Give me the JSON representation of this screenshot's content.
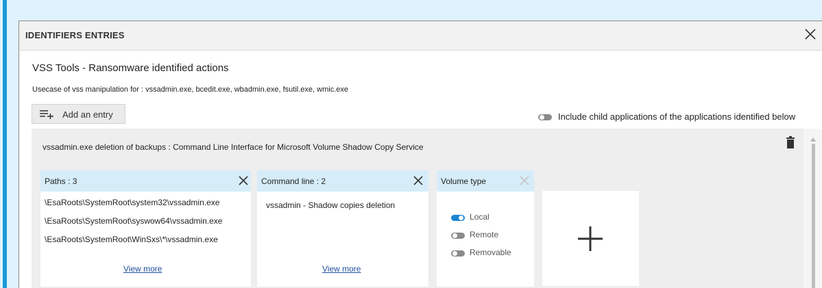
{
  "dialog": {
    "title": "IDENTIFIERS ENTRIES",
    "close_icon": "close-icon"
  },
  "identifier": {
    "name": "VSS Tools - Ransomware identified actions",
    "description": "Usecase of vss manipulation for : vssadmin.exe, bcedit.exe, wbadmin.exe, fsutil.exe, wmic.exe"
  },
  "toolbar": {
    "add_entry_label": "Add an entry",
    "add_entry_icon": "add-list-icon",
    "include_child_label": "Include child applications of the applications identified below",
    "include_child_enabled": false
  },
  "entry": {
    "title": "vssadmin.exe deletion of backups : Command Line Interface for Microsoft Volume Shadow Copy Service",
    "delete_icon": "trash-icon",
    "paths": {
      "header": "Paths : 3",
      "items": [
        "\\EsaRoots\\SystemRoot\\system32\\vssadmin.exe",
        "\\EsaRoots\\SystemRoot\\syswow64\\vssadmin.exe",
        "\\EsaRoots\\SystemRoot\\WinSxs\\*\\vssadmin.exe"
      ],
      "view_more": "View more"
    },
    "command_line": {
      "header": "Command line : 2",
      "items": [
        "vssadmin - Shadow copies deletion"
      ],
      "view_more": "View more"
    },
    "volume_type": {
      "header": "Volume type",
      "options": [
        {
          "label": "Local",
          "enabled": true
        },
        {
          "label": "Remote",
          "enabled": false
        },
        {
          "label": "Removable",
          "enabled": false
        }
      ]
    },
    "add_criterion_icon": "plus-icon"
  },
  "colors": {
    "accent": "#1a9bd7",
    "card_header": "#d6edf9",
    "link": "#1f4f9e",
    "toggle_on": "#1a85d0",
    "toggle_off": "#8a8a8a"
  }
}
